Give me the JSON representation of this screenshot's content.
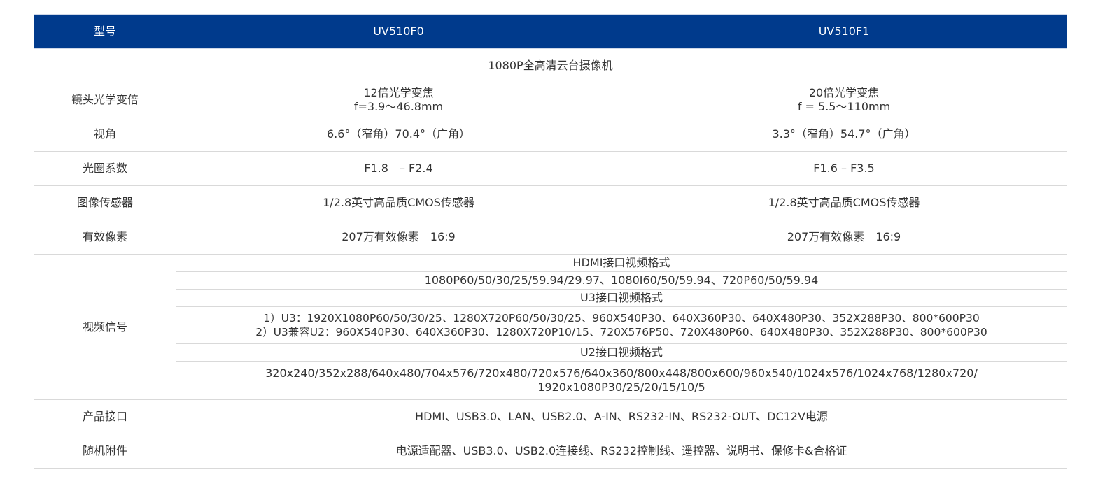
{
  "header": {
    "col_label": "型号",
    "model_a": "UV510F0",
    "model_b": "UV510F1"
  },
  "subtitle": "1080P全高清云台摄像机",
  "rows": {
    "zoom": {
      "label": "镜头光学变倍",
      "a_line1": "12倍光学变焦",
      "a_line2": "f=3.9～46.8mm",
      "b_line1": "20倍光学变焦",
      "b_line2": "f = 5.5～110mm"
    },
    "view": {
      "label": "视角",
      "a": "6.6°（窄角）70.4°（广角）",
      "b": "3.3°（窄角）54.7°（广角）"
    },
    "aperture": {
      "label": "光圈系数",
      "a": "F1.8　– F2.4",
      "b": "F1.6 – F3.5"
    },
    "sensor": {
      "label": "图像传感器",
      "a": "1/2.8英寸高品质CMOS传感器",
      "b": "1/2.8英寸高品质CMOS传感器"
    },
    "pixels": {
      "label": "有效像素",
      "a": "207万有效像素　16:9",
      "b": "207万有效像素　16:9"
    },
    "video": {
      "label": "视频信号",
      "hdmi_title": "HDMI接口视频格式",
      "hdmi_formats": "1080P60/50/30/25/59.94/29.97、1080I60/50/59.94、720P60/50/59.94",
      "u3_title": "U3接口视频格式",
      "u3_line1": "1）U3：1920X1080P60/50/30/25、1280X720P60/50/30/25、960X540P30、640X360P30、640X480P30、352X288P30、800*600P30",
      "u3_line2": "2）U3兼容U2：960X540P30、640X360P30、1280X720P10/15、720X576P50、720X480P60、640X480P30、352X288P30、800*600P30",
      "u2_title": "U2接口视频格式",
      "u2_line1": "320x240/352x288/640x480/704x576/720x480/720x576/640x360/800x448/800x600/960x540/1024x576/1024x768/1280x720/",
      "u2_line2": "1920x1080P30/25/20/15/10/5"
    },
    "ports": {
      "label": "产品接口",
      "value": "HDMI、USB3.0、LAN、USB2.0、A-IN、RS232-IN、RS232-OUT、DC12V电源"
    },
    "accessories": {
      "label": "随机附件",
      "value": "电源适配器、USB3.0、USB2.0连接线、RS232控制线、遥控器、说明书、保修卡&合格证"
    }
  },
  "colors": {
    "header_bg": "#003a8c",
    "header_text": "#ffffff",
    "border": "#d9d9d9",
    "text": "#333333"
  }
}
